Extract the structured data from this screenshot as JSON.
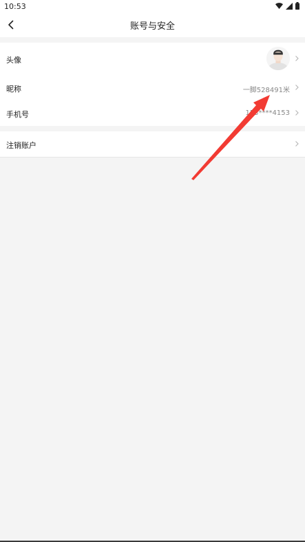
{
  "status_bar": {
    "time": "10:53",
    "icons": [
      "wifi-icon",
      "signal-icon",
      "battery-icon"
    ]
  },
  "header": {
    "title": "账号与安全",
    "back_icon": "chevron-left-icon"
  },
  "account_rows": [
    {
      "label": "头像",
      "value": "",
      "has_avatar": true
    },
    {
      "label": "昵称",
      "value": "一脚528491米"
    },
    {
      "label": "手机号",
      "value": "153****4153"
    }
  ],
  "danger_rows": [
    {
      "label": "注销账户"
    }
  ],
  "annotation": {
    "type": "arrow",
    "color": "#f23b33",
    "points_to": "昵称"
  },
  "colors": {
    "background": "#f4f4f4",
    "card": "#ffffff",
    "arrow": "#f23b33"
  }
}
